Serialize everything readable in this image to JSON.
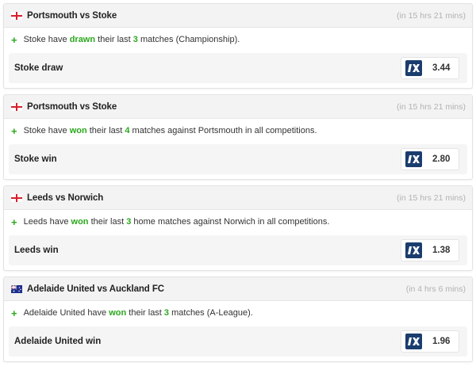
{
  "cards": [
    {
      "flag": "england",
      "title": "Portsmouth vs Stoke",
      "time": "(in 15 hrs 21 mins)",
      "stat": {
        "pre": "Stoke have ",
        "key": "drawn",
        "mid": " their last ",
        "num": "3",
        "post": " matches (Championship)."
      },
      "tip": "Stoke draw",
      "bookmaker_icon": "1xbet-logo-icon",
      "odds": "3.44"
    },
    {
      "flag": "england",
      "title": "Portsmouth vs Stoke",
      "time": "(in 15 hrs 21 mins)",
      "stat": {
        "pre": "Stoke have ",
        "key": "won",
        "mid": " their last ",
        "num": "4",
        "post": " matches against Portsmouth in all competitions."
      },
      "tip": "Stoke win",
      "bookmaker_icon": "1xbet-logo-icon",
      "odds": "2.80"
    },
    {
      "flag": "england",
      "title": "Leeds vs Norwich",
      "time": "(in 15 hrs 21 mins)",
      "stat": {
        "pre": "Leeds have ",
        "key": "won",
        "mid": " their last ",
        "num": "3",
        "post": " home matches against Norwich in all competitions."
      },
      "tip": "Leeds win",
      "bookmaker_icon": "1xbet-logo-icon",
      "odds": "1.38"
    },
    {
      "flag": "australia",
      "title": "Adelaide United vs Auckland FC",
      "time": "(in 4 hrs 6 mins)",
      "stat": {
        "pre": "Adelaide United have ",
        "key": "won",
        "mid": " their last ",
        "num": "3",
        "post": " matches (A-League)."
      },
      "tip": "Adelaide United win",
      "bookmaker_icon": "1xbet-logo-icon",
      "odds": "1.96"
    }
  ],
  "colors": {
    "highlight": "#2aa81c",
    "bookmaker": "#1a3d6e"
  }
}
